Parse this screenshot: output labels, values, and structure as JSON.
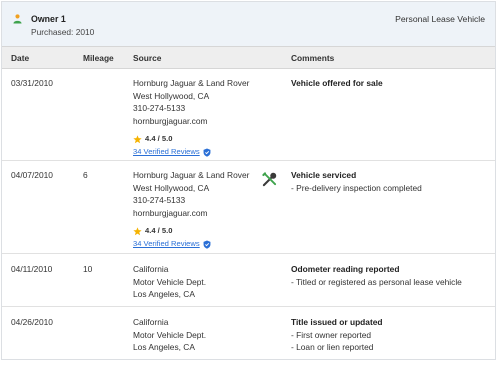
{
  "owner": {
    "title": "Owner 1",
    "purchased": "Purchased: 2010",
    "type": "Personal Lease Vehicle",
    "icon": "person-icon",
    "accent": "#3fa34d"
  },
  "table": {
    "headers": {
      "date": "Date",
      "mileage": "Mileage",
      "source": "Source",
      "comments": "Comments"
    },
    "rows": [
      {
        "date": "03/31/2010",
        "mileage": "",
        "source": [
          "Hornburg Jaguar & Land Rover",
          "West Hollywood, CA",
          "310-274-5133",
          "hornburgjaguar.com"
        ],
        "rating": "4.4 / 5.0",
        "reviews": "34 Verified Reviews",
        "comment_title": "Vehicle offered for sale",
        "comments": []
      },
      {
        "date": "04/07/2010",
        "mileage": "6",
        "source": [
          "Hornburg Jaguar & Land Rover",
          "West Hollywood, CA",
          "310-274-5133",
          "hornburgjaguar.com"
        ],
        "rating": "4.4 / 5.0",
        "reviews": "34 Verified Reviews",
        "icon": "service-tools-icon",
        "comment_title": "Vehicle serviced",
        "comments": [
          "- Pre-delivery inspection completed"
        ]
      },
      {
        "date": "04/11/2010",
        "mileage": "10",
        "source": [
          "California",
          "Motor Vehicle Dept.",
          "Los Angeles, CA"
        ],
        "comment_title": "Odometer reading reported",
        "comments": [
          "- Titled or registered as personal lease vehicle"
        ]
      },
      {
        "date": "04/26/2010",
        "mileage": "",
        "source": [
          "California",
          "Motor Vehicle Dept.",
          "Los Angeles, CA"
        ],
        "comment_title": "Title issued or updated",
        "comments": [
          "- First owner reported",
          "- Loan or lien reported"
        ]
      }
    ]
  },
  "colors": {
    "header_bg": "#eef3f8",
    "table_head_bg": "#eeeeee",
    "link": "#2a6fd6",
    "star": "#f5b301",
    "verified": "#2a6fd6"
  }
}
